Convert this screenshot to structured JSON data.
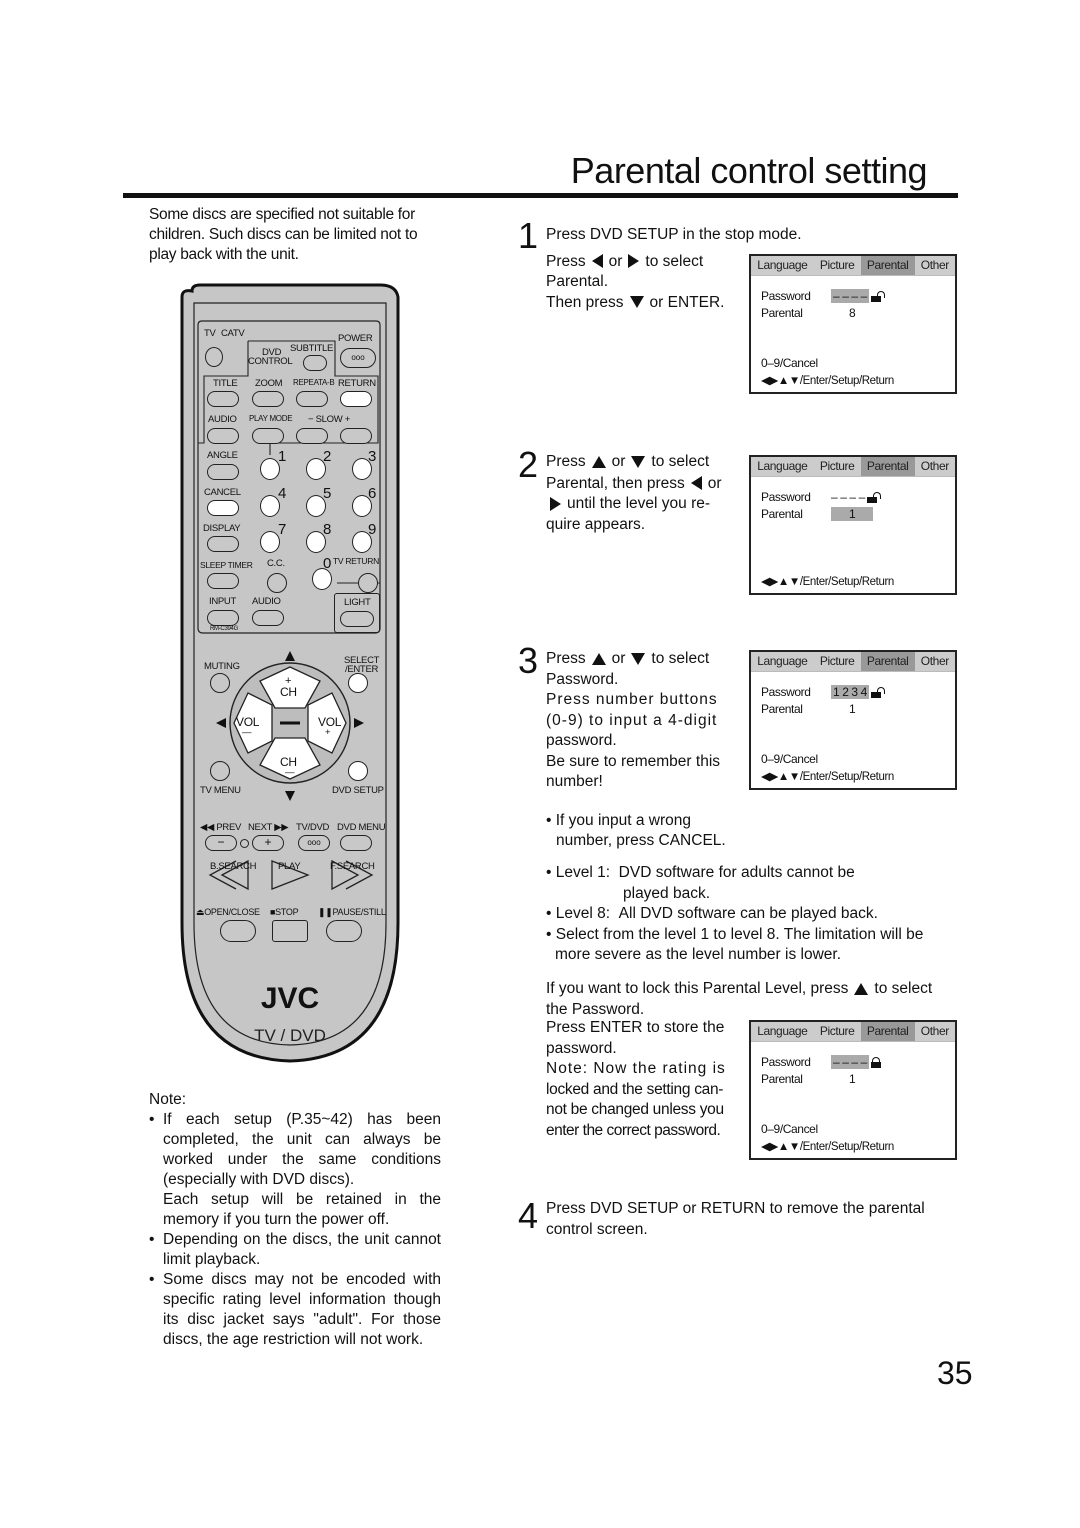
{
  "page": {
    "title": "Parental control setting",
    "page_number": "35",
    "intro": "Some discs are specified not suitable for children. Such discs can be limited not to play back with the unit."
  },
  "remote": {
    "model": "RM-C394G",
    "brand": "JVC",
    "subtitle": "TV / DVD",
    "labels": {
      "tv": "TV",
      "catv": "CATV",
      "dvd_control_1": "DVD",
      "dvd_control_2": "CONTROL",
      "subtitle": "SUBTITLE",
      "power": "POWER",
      "title": "TITLE",
      "zoom": "ZOOM",
      "repeat_ab": "REPEATA-B",
      "return": "RETURN",
      "audio": "AUDIO",
      "play_mode": "PLAY MODE",
      "slow": "−  SLOW  +",
      "angle": "ANGLE",
      "cancel": "CANCEL",
      "display": "DISPLAY",
      "sleep_timer": "SLEEP TIMER",
      "cc": "C.C.",
      "tv_return": "TV RETURN",
      "input": "INPUT",
      "audio2": "AUDIO",
      "light": "LIGHT",
      "muting": "MUTING",
      "select_enter_1": "SELECT",
      "select_enter_2": "/ENTER",
      "ch_plus": "+",
      "ch": "CH",
      "vol": "VOL",
      "vol_minus": "—",
      "vol_plus": "+",
      "ch_minus": "—",
      "tv_menu": "TV MENU",
      "dvd_setup": "DVD SETUP",
      "prev": "◀◀ PREV",
      "next": "NEXT ▶▶",
      "tv_dvd": "TV/DVD",
      "dvd_menu": "DVD MENU",
      "minus": "−",
      "plus": "+",
      "b_search": "B.SEARCH",
      "play": "PLAY",
      "f_search": "F.SEARCH",
      "open_close": "⏏OPEN/CLOSE",
      "stop": "■STOP",
      "pause_still": "❚❚PAUSE/STILL"
    },
    "digits": [
      "1",
      "2",
      "3",
      "4",
      "5",
      "6",
      "7",
      "8",
      "9",
      "0"
    ]
  },
  "steps": [
    {
      "number": "1",
      "line1": "Press DVD SETUP in the stop mode.",
      "text_a": "Press",
      "text_or": "or",
      "text_b": "to select",
      "text_c": "Parental.",
      "text_d": "Then press",
      "text_e": "or ENTER."
    },
    {
      "number": "2",
      "text_a": "Press",
      "text_or": "or",
      "text_b": "to select",
      "text_c": "Parental, then press",
      "text_or2": "or",
      "text_d": "until the level you re-",
      "text_e": "quire appears."
    },
    {
      "number": "3",
      "text_a": "Press",
      "text_or": "or",
      "text_b": "to select",
      "lines": [
        "Password.",
        "Press number buttons",
        "(0-9) to input a 4-digit",
        "password.",
        "Be sure to remember this",
        "number!"
      ],
      "tip_1": "• If you input a wrong",
      "tip_2": "number, press CANCEL."
    },
    {
      "number": "4",
      "line1": "Press DVD SETUP or RETURN to remove the parental",
      "line2": "control screen."
    }
  ],
  "levels": {
    "level1_label": "Level 1:",
    "level1_text_1": "DVD software for adults cannot be",
    "level1_text_2": "played back.",
    "level8_label": "Level 8:",
    "level8_text": "All DVD software can be played back.",
    "select_1": "Select from the level 1 to level 8. The limitation will be",
    "select_2": "more severe as the level number is lower."
  },
  "lock_section": {
    "line1_a": "If you want to lock this Parental Level, press",
    "line1_b": "to select",
    "line2": "the Password.",
    "lines": [
      "Press ENTER to store the",
      "password.",
      "Note: Now the rating is",
      "locked and the setting can-",
      "not be changed unless you",
      "enter the correct password."
    ]
  },
  "osd_screens": [
    {
      "tabs": [
        "Language",
        "Picture",
        "Parental",
        "Other"
      ],
      "selected_tab": "Parental",
      "password_label": "Password",
      "password_value": "– – – –",
      "password_highlight": true,
      "lock": "open",
      "parental_label": "Parental",
      "parental_value": "8",
      "parental_highlight": false,
      "footer1": "0–9/Cancel",
      "footer2": "◀▶▲▼/Enter/Setup/Return"
    },
    {
      "tabs": [
        "Language",
        "Picture",
        "Parental",
        "Other"
      ],
      "selected_tab": "Parental",
      "password_label": "Password",
      "password_value": "– – – –",
      "password_highlight": false,
      "lock": "open",
      "parental_label": "Parental",
      "parental_value": "1",
      "parental_highlight": true,
      "footer1": "",
      "footer2": "◀▶▲▼/Enter/Setup/Return"
    },
    {
      "tabs": [
        "Language",
        "Picture",
        "Parental",
        "Other"
      ],
      "selected_tab": "Parental",
      "password_label": "Password",
      "password_value": "1 2 3 4",
      "password_highlight": true,
      "lock": "open",
      "parental_label": "Parental",
      "parental_value": "1",
      "parental_highlight": false,
      "footer1": "0–9/Cancel",
      "footer2": "◀▶▲▼/Enter/Setup/Return"
    },
    {
      "tabs": [
        "Language",
        "Picture",
        "Parental",
        "Other"
      ],
      "selected_tab": "Parental",
      "password_label": "Password",
      "password_value": "– – – –",
      "password_highlight": true,
      "lock": "closed",
      "parental_label": "Parental",
      "parental_value": "1",
      "parental_highlight": false,
      "footer1": "0–9/Cancel",
      "footer2": "◀▶▲▼/Enter/Setup/Return"
    }
  ],
  "notes": {
    "heading": "Note:",
    "items": [
      "If each setup (P.35~42) has been completed, the unit can always be worked under the same conditions (especially with DVD discs).",
      "Each setup will be retained in the memory if you turn the power off.",
      "Depending on the discs, the unit cannot limit playback.",
      "Some discs may not be encoded with specific rating level information though its disc jacket says \"adult\". For those discs, the age restriction will not work."
    ]
  }
}
